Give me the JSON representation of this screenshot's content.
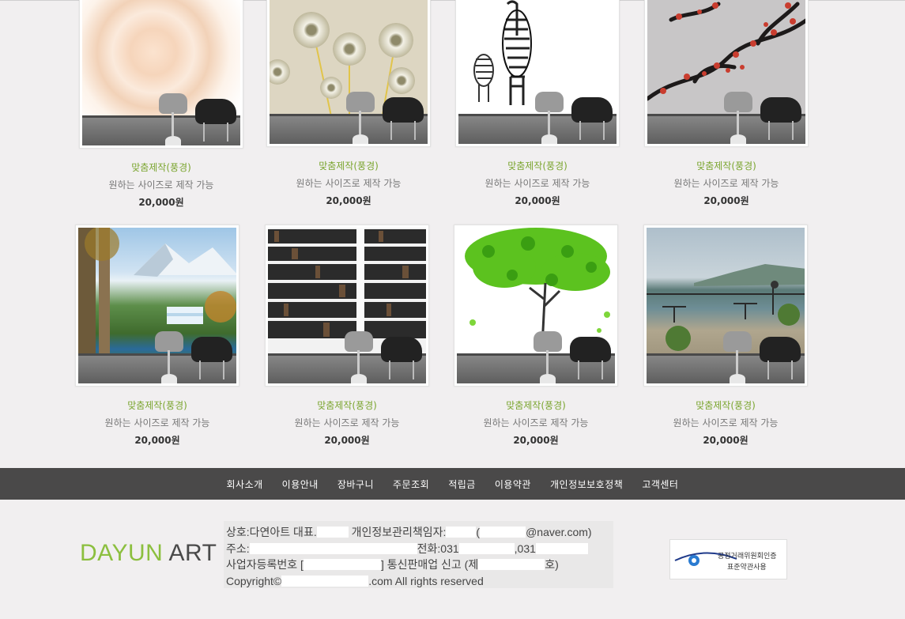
{
  "products": [
    {
      "name": "맞춤제작(풍경)",
      "desc": "원하는 사이즈로 제작 가능",
      "price": "20,000원",
      "art": "rose"
    },
    {
      "name": "맞춤제작(풍경)",
      "desc": "원하는 사이즈로 제작 가능",
      "price": "20,000원",
      "art": "dandelion"
    },
    {
      "name": "맞춤제작(풍경)",
      "desc": "원하는 사이즈로 제작 가능",
      "price": "20,000원",
      "art": "zebra"
    },
    {
      "name": "맞춤제작(풍경)",
      "desc": "원하는 사이즈로 제작 가능",
      "price": "20,000원",
      "art": "plum-blossom"
    },
    {
      "name": "맞춤제작(풍경)",
      "desc": "원하는 사이즈로 제작 가능",
      "price": "20,000원",
      "art": "mountain-waterfall"
    },
    {
      "name": "맞춤제작(풍경)",
      "desc": "원하는 사이즈로 제작 가능",
      "price": "20,000원",
      "art": "bookshelf"
    },
    {
      "name": "맞춤제작(풍경)",
      "desc": "원하는 사이즈로 제작 가능",
      "price": "20,000원",
      "art": "green-tree"
    },
    {
      "name": "맞춤제작(풍경)",
      "desc": "원하는 사이즈로 제작 가능",
      "price": "20,000원",
      "art": "lake-terrace"
    }
  ],
  "footer_nav": [
    "회사소개",
    "이용안내",
    "장바구니",
    "주문조회",
    "적립금",
    "이용약관",
    "개인정보보호정책",
    "고객센터"
  ],
  "logo": {
    "part1": "DAYUN",
    "part2": "ART"
  },
  "company_info": {
    "l1_a": "상호:다연아트  대표.",
    "l1_b": "개인정보관리책임자:",
    "l1_c": "(",
    "l1_d": "@naver.com)",
    "l2_a": "주소:",
    "l2_b": "전화:031",
    "l2_c": ",031",
    "l3_a": "사업자등록번호 [",
    "l3_b": "] 통신판매업 신고 (제",
    "l3_c": "호)",
    "l4_a": "Copyright©",
    "l4_b": ".com All rights reserved"
  },
  "badge": {
    "line1": "공정거래위원회인증",
    "line2": "표준약관사용"
  },
  "colors": {
    "accent": "#8cbf3f",
    "footer_bg": "#4a4949",
    "page_bg": "#f1eff0"
  }
}
